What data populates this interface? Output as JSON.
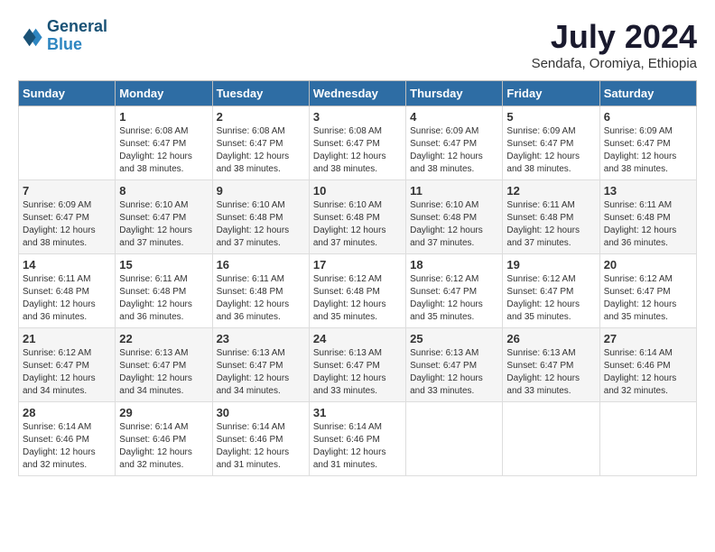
{
  "header": {
    "logo_text_general": "General",
    "logo_text_blue": "Blue",
    "month_title": "July 2024",
    "subtitle": "Sendafa, Oromiya, Ethiopia"
  },
  "calendar": {
    "days_of_week": [
      "Sunday",
      "Monday",
      "Tuesday",
      "Wednesday",
      "Thursday",
      "Friday",
      "Saturday"
    ],
    "weeks": [
      [
        {
          "day": "",
          "info": ""
        },
        {
          "day": "1",
          "info": "Sunrise: 6:08 AM\nSunset: 6:47 PM\nDaylight: 12 hours\nand 38 minutes."
        },
        {
          "day": "2",
          "info": "Sunrise: 6:08 AM\nSunset: 6:47 PM\nDaylight: 12 hours\nand 38 minutes."
        },
        {
          "day": "3",
          "info": "Sunrise: 6:08 AM\nSunset: 6:47 PM\nDaylight: 12 hours\nand 38 minutes."
        },
        {
          "day": "4",
          "info": "Sunrise: 6:09 AM\nSunset: 6:47 PM\nDaylight: 12 hours\nand 38 minutes."
        },
        {
          "day": "5",
          "info": "Sunrise: 6:09 AM\nSunset: 6:47 PM\nDaylight: 12 hours\nand 38 minutes."
        },
        {
          "day": "6",
          "info": "Sunrise: 6:09 AM\nSunset: 6:47 PM\nDaylight: 12 hours\nand 38 minutes."
        }
      ],
      [
        {
          "day": "7",
          "info": "Sunrise: 6:09 AM\nSunset: 6:47 PM\nDaylight: 12 hours\nand 38 minutes."
        },
        {
          "day": "8",
          "info": "Sunrise: 6:10 AM\nSunset: 6:47 PM\nDaylight: 12 hours\nand 37 minutes."
        },
        {
          "day": "9",
          "info": "Sunrise: 6:10 AM\nSunset: 6:48 PM\nDaylight: 12 hours\nand 37 minutes."
        },
        {
          "day": "10",
          "info": "Sunrise: 6:10 AM\nSunset: 6:48 PM\nDaylight: 12 hours\nand 37 minutes."
        },
        {
          "day": "11",
          "info": "Sunrise: 6:10 AM\nSunset: 6:48 PM\nDaylight: 12 hours\nand 37 minutes."
        },
        {
          "day": "12",
          "info": "Sunrise: 6:11 AM\nSunset: 6:48 PM\nDaylight: 12 hours\nand 37 minutes."
        },
        {
          "day": "13",
          "info": "Sunrise: 6:11 AM\nSunset: 6:48 PM\nDaylight: 12 hours\nand 36 minutes."
        }
      ],
      [
        {
          "day": "14",
          "info": "Sunrise: 6:11 AM\nSunset: 6:48 PM\nDaylight: 12 hours\nand 36 minutes."
        },
        {
          "day": "15",
          "info": "Sunrise: 6:11 AM\nSunset: 6:48 PM\nDaylight: 12 hours\nand 36 minutes."
        },
        {
          "day": "16",
          "info": "Sunrise: 6:11 AM\nSunset: 6:48 PM\nDaylight: 12 hours\nand 36 minutes."
        },
        {
          "day": "17",
          "info": "Sunrise: 6:12 AM\nSunset: 6:48 PM\nDaylight: 12 hours\nand 35 minutes."
        },
        {
          "day": "18",
          "info": "Sunrise: 6:12 AM\nSunset: 6:47 PM\nDaylight: 12 hours\nand 35 minutes."
        },
        {
          "day": "19",
          "info": "Sunrise: 6:12 AM\nSunset: 6:47 PM\nDaylight: 12 hours\nand 35 minutes."
        },
        {
          "day": "20",
          "info": "Sunrise: 6:12 AM\nSunset: 6:47 PM\nDaylight: 12 hours\nand 35 minutes."
        }
      ],
      [
        {
          "day": "21",
          "info": "Sunrise: 6:12 AM\nSunset: 6:47 PM\nDaylight: 12 hours\nand 34 minutes."
        },
        {
          "day": "22",
          "info": "Sunrise: 6:13 AM\nSunset: 6:47 PM\nDaylight: 12 hours\nand 34 minutes."
        },
        {
          "day": "23",
          "info": "Sunrise: 6:13 AM\nSunset: 6:47 PM\nDaylight: 12 hours\nand 34 minutes."
        },
        {
          "day": "24",
          "info": "Sunrise: 6:13 AM\nSunset: 6:47 PM\nDaylight: 12 hours\nand 33 minutes."
        },
        {
          "day": "25",
          "info": "Sunrise: 6:13 AM\nSunset: 6:47 PM\nDaylight: 12 hours\nand 33 minutes."
        },
        {
          "day": "26",
          "info": "Sunrise: 6:13 AM\nSunset: 6:47 PM\nDaylight: 12 hours\nand 33 minutes."
        },
        {
          "day": "27",
          "info": "Sunrise: 6:14 AM\nSunset: 6:46 PM\nDaylight: 12 hours\nand 32 minutes."
        }
      ],
      [
        {
          "day": "28",
          "info": "Sunrise: 6:14 AM\nSunset: 6:46 PM\nDaylight: 12 hours\nand 32 minutes."
        },
        {
          "day": "29",
          "info": "Sunrise: 6:14 AM\nSunset: 6:46 PM\nDaylight: 12 hours\nand 32 minutes."
        },
        {
          "day": "30",
          "info": "Sunrise: 6:14 AM\nSunset: 6:46 PM\nDaylight: 12 hours\nand 31 minutes."
        },
        {
          "day": "31",
          "info": "Sunrise: 6:14 AM\nSunset: 6:46 PM\nDaylight: 12 hours\nand 31 minutes."
        },
        {
          "day": "",
          "info": ""
        },
        {
          "day": "",
          "info": ""
        },
        {
          "day": "",
          "info": ""
        }
      ]
    ]
  }
}
